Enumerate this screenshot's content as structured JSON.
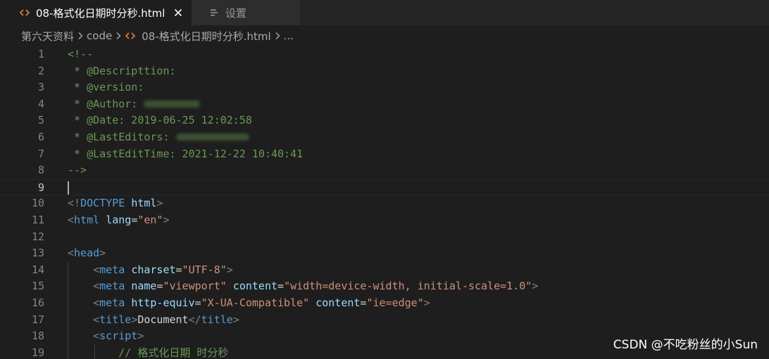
{
  "tabs": [
    {
      "label": "08-格式化日期时分秒.html",
      "icon": "html-code-icon",
      "icon_color": "#e37933",
      "active": true
    },
    {
      "label": "设置",
      "icon": "settings-list-icon",
      "active": false
    }
  ],
  "breadcrumb": {
    "items": [
      "第六天资料",
      "code",
      "08-格式化日期时分秒.html",
      "..."
    ]
  },
  "editor": {
    "current_line": 9,
    "lines": [
      {
        "n": "1",
        "parts": [
          [
            "c",
            "<!--"
          ]
        ]
      },
      {
        "n": "2",
        "parts": [
          [
            "c",
            " * @Descripttion:"
          ]
        ]
      },
      {
        "n": "3",
        "parts": [
          [
            "c",
            " * @version:"
          ]
        ]
      },
      {
        "n": "4",
        "parts": [
          [
            "c",
            " * @Author: "
          ]
        ],
        "redacted": true
      },
      {
        "n": "5",
        "parts": [
          [
            "c",
            " * @Date: 2019-06-25 12:02:58"
          ]
        ]
      },
      {
        "n": "6",
        "parts": [
          [
            "c",
            " * @LastEditors: "
          ]
        ],
        "redacted": true
      },
      {
        "n": "7",
        "parts": [
          [
            "c",
            " * @LastEditTime: 2021-12-22 10:40:41"
          ]
        ]
      },
      {
        "n": "8",
        "parts": [
          [
            "c",
            "-->"
          ]
        ]
      },
      {
        "n": "9",
        "parts": []
      },
      {
        "n": "10",
        "parts": [
          [
            "p",
            "<!"
          ],
          [
            "t",
            "DOCTYPE"
          ],
          [
            "x",
            " "
          ],
          [
            "a",
            "html"
          ],
          [
            "p",
            ">"
          ]
        ]
      },
      {
        "n": "11",
        "parts": [
          [
            "p",
            "<"
          ],
          [
            "t",
            "html"
          ],
          [
            "x",
            " "
          ],
          [
            "a",
            "lang"
          ],
          [
            "x",
            "="
          ],
          [
            "s",
            "\"en\""
          ],
          [
            "p",
            ">"
          ]
        ]
      },
      {
        "n": "12",
        "parts": []
      },
      {
        "n": "13",
        "parts": [
          [
            "p",
            "<"
          ],
          [
            "t",
            "head"
          ],
          [
            "p",
            ">"
          ]
        ]
      },
      {
        "n": "14",
        "parts": [
          [
            "x",
            "    "
          ],
          [
            "p",
            "<"
          ],
          [
            "t",
            "meta"
          ],
          [
            "x",
            " "
          ],
          [
            "a",
            "charset"
          ],
          [
            "x",
            "="
          ],
          [
            "s",
            "\"UTF-8\""
          ],
          [
            "p",
            ">"
          ]
        ]
      },
      {
        "n": "15",
        "parts": [
          [
            "x",
            "    "
          ],
          [
            "p",
            "<"
          ],
          [
            "t",
            "meta"
          ],
          [
            "x",
            " "
          ],
          [
            "a",
            "name"
          ],
          [
            "x",
            "="
          ],
          [
            "s",
            "\"viewport\""
          ],
          [
            "x",
            " "
          ],
          [
            "a",
            "content"
          ],
          [
            "x",
            "="
          ],
          [
            "s",
            "\"width=device-width, initial-scale=1.0\""
          ],
          [
            "p",
            ">"
          ]
        ]
      },
      {
        "n": "16",
        "parts": [
          [
            "x",
            "    "
          ],
          [
            "p",
            "<"
          ],
          [
            "t",
            "meta"
          ],
          [
            "x",
            " "
          ],
          [
            "a",
            "http-equiv"
          ],
          [
            "x",
            "="
          ],
          [
            "s",
            "\"X-UA-Compatible\""
          ],
          [
            "x",
            " "
          ],
          [
            "a",
            "content"
          ],
          [
            "x",
            "="
          ],
          [
            "s",
            "\"ie=edge\""
          ],
          [
            "p",
            ">"
          ]
        ]
      },
      {
        "n": "17",
        "parts": [
          [
            "x",
            "    "
          ],
          [
            "p",
            "<"
          ],
          [
            "t",
            "title"
          ],
          [
            "p",
            ">"
          ],
          [
            "x",
            "Document"
          ],
          [
            "p",
            "</"
          ],
          [
            "t",
            "title"
          ],
          [
            "p",
            ">"
          ]
        ]
      },
      {
        "n": "18",
        "parts": [
          [
            "x",
            "    "
          ],
          [
            "p",
            "<"
          ],
          [
            "t",
            "script"
          ],
          [
            "p",
            ">"
          ]
        ]
      },
      {
        "n": "19",
        "parts": [
          [
            "x",
            "        "
          ],
          [
            "c",
            "// 格式化日期 时分秒"
          ]
        ]
      }
    ]
  },
  "watermark": "CSDN @不吃粉丝的小Sun"
}
